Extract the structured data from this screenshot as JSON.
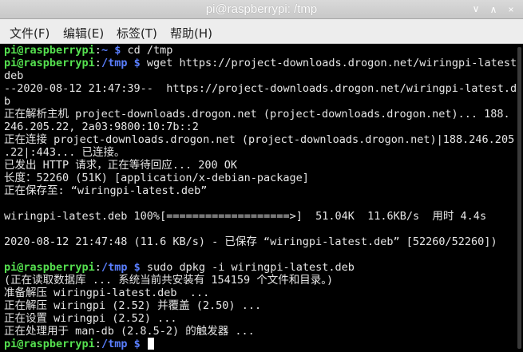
{
  "window": {
    "title": "pi@raspberrypi: /tmp",
    "minimize_glyph": "∨",
    "maximize_glyph": "∧",
    "close_glyph": "×"
  },
  "menu": [
    "文件(F)",
    "编辑(E)",
    "标签(T)",
    "帮助(H)"
  ],
  "terminal": {
    "colors": {
      "user": "#55e04f",
      "path": "#5a7fff",
      "text": "#e6e6e6",
      "background": "#000000"
    },
    "prompt_user": "pi@raspberrypi",
    "lines": [
      {
        "prompt": {
          "user": "pi@raspberrypi",
          "sep": ":",
          "path": "~",
          "sym": " $ "
        },
        "text": "cd /tmp"
      },
      {
        "prompt": {
          "user": "pi@raspberrypi",
          "sep": ":",
          "path": "/tmp",
          "sym": " $ "
        },
        "text": "wget https://project-downloads.drogon.net/wiringpi-latest."
      },
      {
        "text": "deb"
      },
      {
        "text": "--2020-08-12 21:47:39--  https://project-downloads.drogon.net/wiringpi-latest.de"
      },
      {
        "text": "b"
      },
      {
        "text": "正在解析主机 project-downloads.drogon.net (project-downloads.drogon.net)... 188."
      },
      {
        "text": "246.205.22, 2a03:9800:10:7b::2"
      },
      {
        "text": "正在连接 project-downloads.drogon.net (project-downloads.drogon.net)|188.246.205"
      },
      {
        "text": ".22|:443... 已连接。"
      },
      {
        "text": "已发出 HTTP 请求，正在等待回应... 200 OK"
      },
      {
        "text": "长度：52260 (51K) [application/x-debian-package]"
      },
      {
        "text": "正在保存至: “wiringpi-latest.deb”"
      },
      {
        "text": ""
      },
      {
        "text": "wiringpi-latest.deb 100%[===================>]  51.04K  11.6KB/s  用时 4.4s"
      },
      {
        "text": ""
      },
      {
        "text": "2020-08-12 21:47:48 (11.6 KB/s) - 已保存 “wiringpi-latest.deb” [52260/52260])"
      },
      {
        "text": ""
      },
      {
        "prompt": {
          "user": "pi@raspberrypi",
          "sep": ":",
          "path": "/tmp",
          "sym": " $ "
        },
        "text": "sudo dpkg -i wiringpi-latest.deb"
      },
      {
        "text": "(正在读取数据库 ... 系统当前共安装有 154159 个文件和目录。)"
      },
      {
        "text": "准备解压 wiringpi-latest.deb  ..."
      },
      {
        "text": "正在解压 wiringpi (2.52) 并覆盖 (2.50) ..."
      },
      {
        "text": "正在设置 wiringpi (2.52) ..."
      },
      {
        "text": "正在处理用于 man-db (2.8.5-2) 的触发器 ..."
      },
      {
        "prompt": {
          "user": "pi@raspberrypi",
          "sep": ":",
          "path": "/tmp",
          "sym": " $ "
        },
        "text": "",
        "cursor": true
      }
    ]
  }
}
